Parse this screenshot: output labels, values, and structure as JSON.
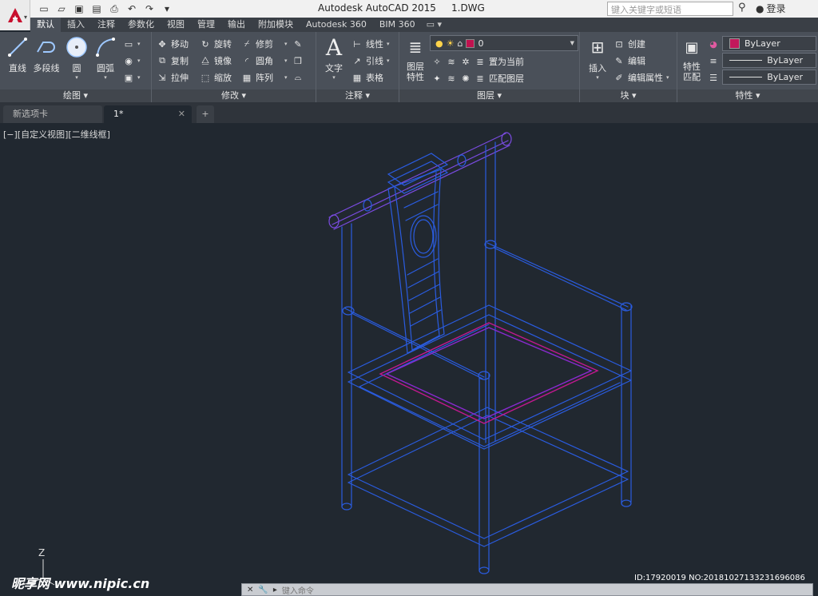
{
  "titlebar": {
    "title": "Autodesk AutoCAD 2015     1.DWG",
    "search_placeholder": "键入关键字或短语",
    "login_label": "登录"
  },
  "ribbon_tabs": [
    "默认",
    "插入",
    "注释",
    "参数化",
    "视图",
    "管理",
    "输出",
    "附加模块",
    "Autodesk 360",
    "BIM 360"
  ],
  "draw_panel": {
    "title": "绘图",
    "line": "直线",
    "polyline": "多段线",
    "circle": "圆",
    "arc": "圆弧"
  },
  "modify_panel": {
    "title": "修改",
    "move": "移动",
    "copy": "复制",
    "stretch": "拉伸",
    "rotate": "旋转",
    "mirror": "镜像",
    "scale": "缩放",
    "trim": "修剪",
    "fillet": "圆角",
    "array": "阵列"
  },
  "annotation_panel": {
    "title": "注释",
    "text": "文字",
    "linear": "线性",
    "leader": "引线",
    "table": "表格"
  },
  "layers_panel": {
    "title": "图层",
    "layer_props": "图层\n特性",
    "current_layer": "0",
    "set_current": "置为当前",
    "match_layer": "匹配图层",
    "layer_color": "#c0124f"
  },
  "block_panel": {
    "title": "块",
    "insert": "插入",
    "create": "创建",
    "edit": "编辑",
    "edit_attr": "编辑属性"
  },
  "properties_panel": {
    "title": "特性",
    "match": "特性\n匹配",
    "color": "ByLayer",
    "linetype": "ByLayer",
    "lineweight": "ByLayer"
  },
  "doc_tabs": [
    "新选项卡",
    "1*"
  ],
  "viewport": {
    "label": "[−][自定义视图][二维线框]",
    "ucs_z": "Z"
  },
  "command": {
    "placeholder": "键入命令"
  },
  "overlay": {
    "watermark": "昵享网 www.nipic.cn",
    "image_id": "ID:17920019 NO:20181027133231696086"
  },
  "colors": {
    "chair_blue": "#2a5ce0",
    "chair_purple": "#7a4be0",
    "seat_magenta": "#c2188f",
    "background": "#212830"
  }
}
